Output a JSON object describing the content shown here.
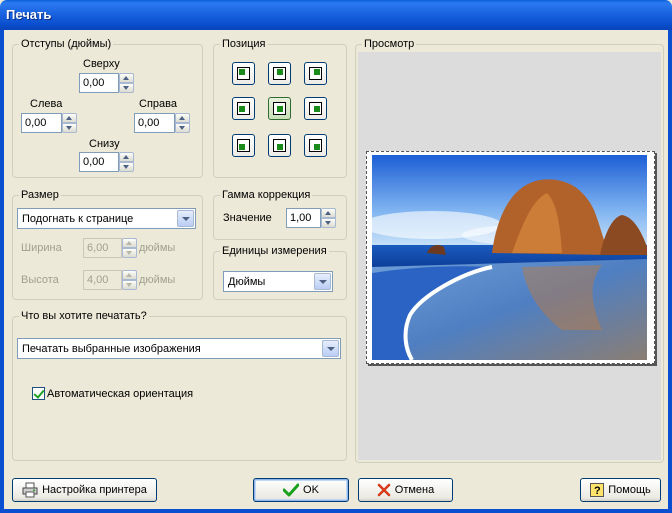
{
  "window": {
    "title": "Печать"
  },
  "margins": {
    "legend": "Отступы (дюймы)",
    "top": {
      "label": "Сверху",
      "value": "0,00"
    },
    "left": {
      "label": "Слева",
      "value": "0,00"
    },
    "right": {
      "label": "Справа",
      "value": "0,00"
    },
    "bottom": {
      "label": "Снизу",
      "value": "0,00"
    }
  },
  "position": {
    "legend": "Позиция",
    "selected": "center",
    "grid": [
      "top-left",
      "top-center",
      "top-right",
      "middle-left",
      "center",
      "middle-right",
      "bottom-left",
      "bottom-center",
      "bottom-right"
    ]
  },
  "size": {
    "legend": "Размер",
    "mode": "Подогнать к странице",
    "width": {
      "label": "Ширина",
      "value": "6,00",
      "unit": "дюймы"
    },
    "height": {
      "label": "Высота",
      "value": "4,00",
      "unit": "дюймы"
    }
  },
  "gamma": {
    "legend": "Гамма коррекция",
    "label": "Значение",
    "value": "1,00"
  },
  "units": {
    "legend": "Единицы измерения",
    "value": "Дюймы"
  },
  "what": {
    "legend": "Что вы хотите печатать?",
    "value": "Печатать выбранные изображения",
    "auto_orient": {
      "label": "Автоматическая ориентация",
      "checked": true
    }
  },
  "preview": {
    "legend": "Просмотр"
  },
  "buttons": {
    "printer_setup": "Настройка принтера",
    "ok": "OK",
    "cancel": "Отмена",
    "help": "Помощь"
  },
  "colors": {
    "title_bar": "#0b4fcf",
    "window_bg": "#ece9d8",
    "ok_check": "#1aa01a",
    "cancel_x": "#d63a1a"
  }
}
